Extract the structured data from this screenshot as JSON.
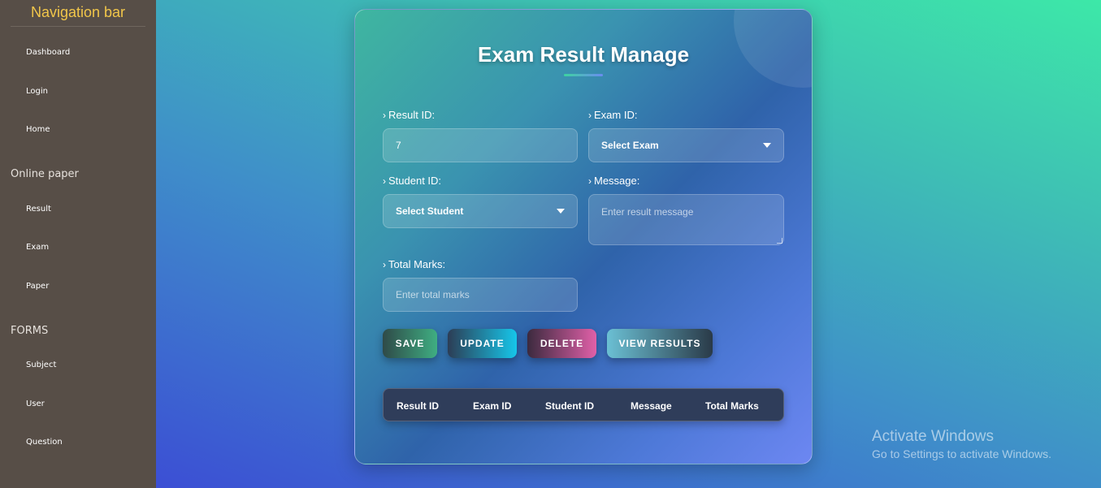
{
  "sidebar": {
    "title": "Navigation bar",
    "links_top": [
      "Dashboard",
      "Login",
      "Home"
    ],
    "section_online": "Online paper",
    "links_online": [
      "Result",
      "Exam",
      "Paper"
    ],
    "section_forms": "FORMS",
    "links_forms": [
      "Subject",
      "User",
      "Question"
    ]
  },
  "form": {
    "title": "Exam Result Manage",
    "result_id_label": "Result ID:",
    "result_id_value": "7",
    "exam_id_label": "Exam ID:",
    "exam_select": "Select Exam",
    "student_id_label": "Student ID:",
    "student_select": "Select Student",
    "message_label": "Message:",
    "message_placeholder": "Enter result message",
    "total_marks_label": "Total Marks:",
    "total_marks_placeholder": "Enter total marks",
    "arrow": "›"
  },
  "buttons": {
    "save": "SAVE",
    "update": "UPDATE",
    "delete": "DELETE",
    "view": "VIEW RESULTS"
  },
  "table": {
    "columns": [
      "Result ID",
      "Exam ID",
      "Student ID",
      "Message",
      "Total Marks"
    ]
  },
  "watermark": {
    "title": "Activate Windows",
    "subtitle": "Go to Settings to activate Windows."
  },
  "colors": {
    "sidebar_bg": "#574e47",
    "nav_title": "#f1c64a",
    "table_head": "#2f3d5a"
  }
}
